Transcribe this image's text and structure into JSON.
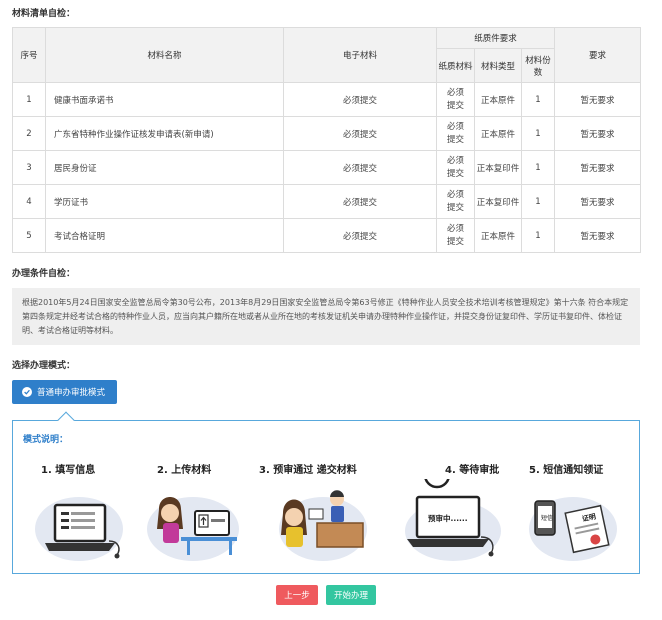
{
  "materials": {
    "title": "材料清单自检：",
    "headers": {
      "seq": "序号",
      "name": "材料名称",
      "electronic": "电子材料",
      "paper_group": "纸质件要求",
      "paper": "纸质材料",
      "type": "材料类型",
      "copies": "材料份数",
      "requirement": "要求"
    },
    "rows": [
      {
        "seq": "1",
        "name": "健康书面承诺书",
        "electronic": "必须提交",
        "paper": "必须提交",
        "type": "正本原件",
        "copies": "1",
        "requirement": "暂无要求"
      },
      {
        "seq": "2",
        "name": "广东省特种作业操作证核发申请表(新申请)",
        "electronic": "必须提交",
        "paper": "必须提交",
        "type": "正本原件",
        "copies": "1",
        "requirement": "暂无要求"
      },
      {
        "seq": "3",
        "name": "居民身份证",
        "electronic": "必须提交",
        "paper": "必须提交",
        "type": "正本复印件",
        "copies": "1",
        "requirement": "暂无要求"
      },
      {
        "seq": "4",
        "name": "学历证书",
        "electronic": "必须提交",
        "paper": "必须提交",
        "type": "正本复印件",
        "copies": "1",
        "requirement": "暂无要求"
      },
      {
        "seq": "5",
        "name": "考试合格证明",
        "electronic": "必须提交",
        "paper": "必须提交",
        "type": "正本原件",
        "copies": "1",
        "requirement": "暂无要求"
      }
    ]
  },
  "conditions": {
    "title": "办理条件自检：",
    "text": "根据2010年5月24日国家安全监管总局令第30号公布，2013年8月29日国家安全监管总局令第63号修正《特种作业人员安全技术培训考核管理规定》第十六条 符合本规定第四条规定并经考试合格的特种作业人员，应当向其户籍所在地或者从业所在地的考核发证机关申请办理特种作业操作证，并提交身份证复印件、学历证书复印件、体检证明、考试合格证明等材料。"
  },
  "mode": {
    "title": "选择办理模式：",
    "selected": "普通申办审批模式",
    "desc_title": "模式说明：",
    "steps": [
      {
        "label": "1. 填写信息"
      },
      {
        "label": "2. 上传材料"
      },
      {
        "label": "3. 预审通过  递交材料"
      },
      {
        "label": "4. 等待审批",
        "screen_text": "预审中......"
      },
      {
        "label": "5. 短信通知领证",
        "phone_text": "短信",
        "cert_text": "证明"
      }
    ]
  },
  "buttons": {
    "prev": "上一步",
    "start": "开始办理"
  },
  "colors": {
    "primary": "#2f7fca",
    "border_blue": "#58a8dc",
    "prev": "#ef5a5e",
    "start": "#33c6a0"
  }
}
